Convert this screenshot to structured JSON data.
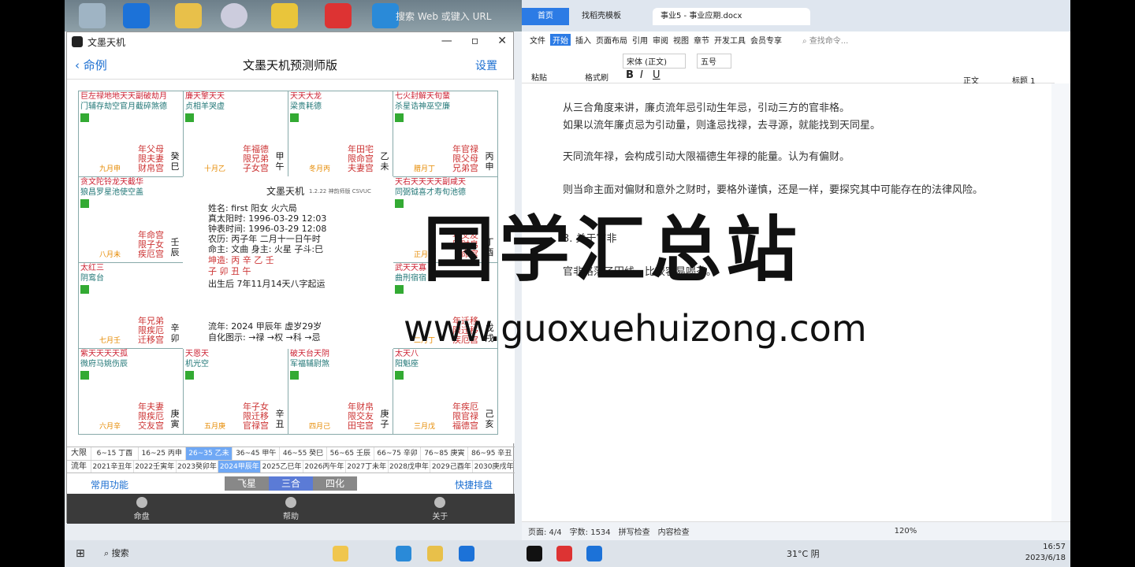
{
  "desktop": {
    "search_placeholder": "搜索 Web 或键入 URL"
  },
  "app": {
    "window_title": "文墨天机",
    "back_label": "命例",
    "title": "文墨天机预测师版",
    "settings_label": "设置",
    "cells": [
      {
        "stars": "巨左禄地地天天副破劫月",
        "stars2": "门辅存劫空官月截碎煞德",
        "house": "年父母\n限夫妻\n财帛宫",
        "stem": "癸\n巳",
        "age": "九月申"
      },
      {
        "stars": "廉天擎天天",
        "stars2": "贞相羊哭虚",
        "house": "年福德\n限兄弟\n子女宫",
        "stem": "甲\n午",
        "age": "十月乙"
      },
      {
        "stars": "天天大龙",
        "stars2": "梁贵耗德",
        "house": "年田宅\n限命宫\n夫妻宫",
        "stem": "乙\n未",
        "age": "冬月丙"
      },
      {
        "stars": "七火封解天旬蜚",
        "stars2": "杀星诰神巫空廉",
        "house": "年官禄\n限父母\n兄弟宫",
        "stem": "丙\n申",
        "age": "腊月丁"
      },
      {
        "stars": "贪文陀铃龙天截华",
        "stars2": "狼昌罗星池使空盖",
        "house": "年命宫\n限子女\n疾厄宫",
        "stem": "壬\n辰",
        "age": "八月未"
      },
      {
        "stars": "天右天天天天副咸天",
        "stars2": "同弼钺喜才寿旬池德",
        "house": "年交友\n限财帛\n命宫",
        "stem": "丁\n酉",
        "age": "正月丙"
      },
      {
        "stars": "太红三",
        "stars2": "阴鸾台",
        "house": "年兄弟\n限疾厄\n迁移宫",
        "stem": "辛\n卯",
        "age": "七月壬"
      },
      {
        "stars": "武天天寡",
        "stars2": "曲刑宿宿",
        "house": "年迁移\n限迁移\n疾厄宫",
        "stem": "戊\n戌",
        "age": "二月丁"
      },
      {
        "stars": "紫天天天天孤",
        "stars2": "微府马姚伤辰",
        "house": "年夫妻\n限疾厄\n交友宫",
        "stem": "庚\n寅",
        "age": "六月辛"
      },
      {
        "stars": "天恩天",
        "stars2": "机光空",
        "house": "年子女\n限迁移\n官禄宫",
        "stem": "辛\n丑",
        "age": "五月庚"
      },
      {
        "stars": "破天台天阴",
        "stars2": "军福辅尉煞",
        "house": "年财帛\n限交友\n田宅宫",
        "stem": "庚\n子",
        "age": "四月己"
      },
      {
        "stars": "太天八",
        "stars2": "阳魁座",
        "house": "年疾厄\n限官禄\n福德宫",
        "stem": "己\n亥",
        "age": "三月戊"
      }
    ],
    "center": {
      "title": "文墨天机",
      "version": "1.2.22 神韵师版 CSVUC",
      "l1": "姓名: first        阳女 火六局",
      "l2": "真太阳时: 1996-03-29 12:03",
      "l3": "钟表时间: 1996-03-29 12:08",
      "l4": "农历: 丙子年 二月十一日午时",
      "l5": "命主: 文曲 身主: 火星 子斗:巳",
      "l6": "坤造:  丙     辛     乙     壬",
      "l7": "         子     卯     丑     午",
      "l8": "出生后 7年11月14天八字起运",
      "l9": "流年: 2024 甲辰年  虚岁29岁",
      "l10": "自化图示:  →禄  →权  →科  →忌"
    },
    "daxian_label": "大限",
    "daxian": [
      "6~15 丁酉",
      "16~25 丙申",
      "26~35 乙未",
      "36~45 甲午",
      "46~55 癸巳",
      "56~65 壬辰",
      "66~75 辛卯",
      "76~85 庚寅",
      "86~95 辛丑"
    ],
    "daxian_selected": 2,
    "liunian_label": "流年",
    "liunian": [
      "2021辛丑年",
      "2022壬寅年",
      "2023癸卯年",
      "2024甲辰年",
      "2025乙巳年",
      "2026丙午年",
      "2027丁未年",
      "2028戊申年",
      "2029己酉年",
      "2030庚戌年"
    ],
    "liunian_selected": 3,
    "common_label": "常用功能",
    "seg": [
      "飞星",
      "三合",
      "四化"
    ],
    "seg_selected": 1,
    "quick_label": "快捷排盘",
    "bottom": [
      "命盘",
      "帮助",
      "关于"
    ]
  },
  "wps": {
    "tab_home": "首页",
    "tab1": "找稻壳模板",
    "tab2": "事业5 - 事业应期.docx",
    "menu": [
      "文件",
      "开始",
      "插入",
      "页面布局",
      "引用",
      "审阅",
      "视图",
      "章节",
      "开发工具",
      "会员专享"
    ],
    "menu_search": "查找命令...",
    "font": "宋体 (正文)",
    "size": "五号",
    "style1": "正文",
    "style2": "标题 1",
    "paste": "粘贴",
    "format_brush": "格式刷",
    "paras": [
      "从三合角度来讲，廉贞流年忌引动生年忌，引动三方的官非格。",
      "如果以流年廉贞忌为引动量，则逢忌找禄，去寻源，就能找到天同星。",
      "天同流年禄，会构成引动大限福德生年禄的能量。认为有偏财。",
      "则当命主面对偏财和意外之财时，要格外谨慎，还是一样，要探究其中可能存在的法律风险。",
      "3. 关于官非",
      "官非格落了田线，比较容易喝茶。"
    ],
    "status": {
      "page": "页面: 4/4",
      "words": "字数: 1534",
      "spell": "拼写检查",
      "content": "内容检查",
      "zoom": "120%"
    }
  },
  "taskbar": {
    "search": "搜索",
    "weather": "31°C 阴",
    "time": "16:57",
    "date": "2023/6/18"
  },
  "watermark": {
    "line1": "国学汇总站",
    "line2": "www.guoxuehuizong.com"
  }
}
